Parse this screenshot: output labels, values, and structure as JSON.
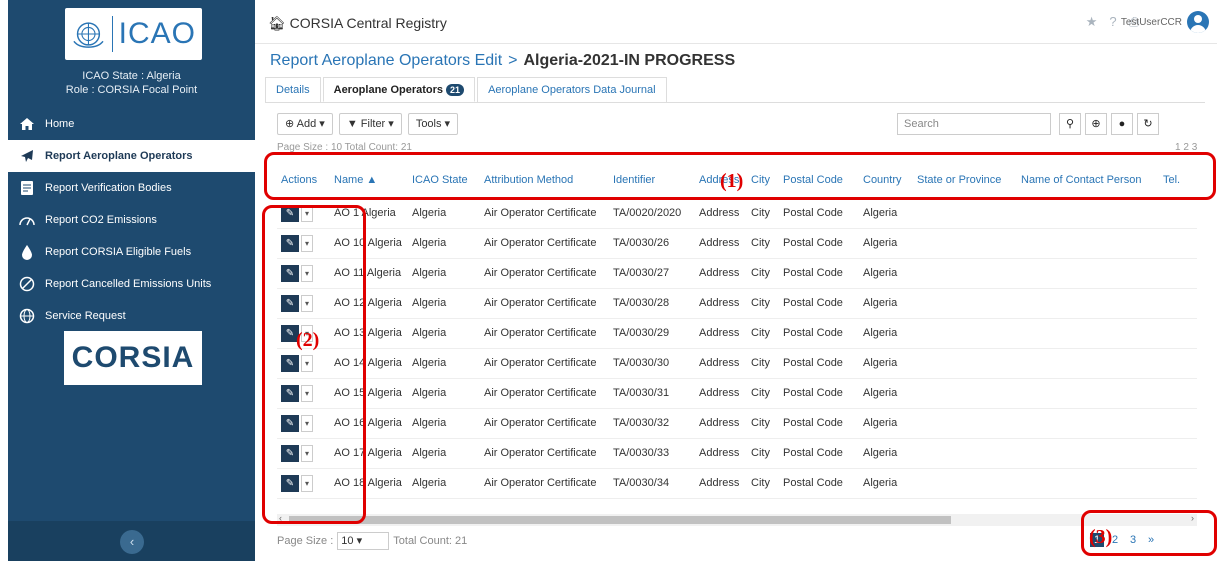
{
  "sidebar": {
    "logo_text": "ICAO",
    "state_line": "ICAO State : Algeria",
    "role_line": "Role : CORSIA Focal Point",
    "items": [
      {
        "label": "Home"
      },
      {
        "label": "Report Aeroplane Operators"
      },
      {
        "label": "Report Verification Bodies"
      },
      {
        "label": "Report CO2 Emissions"
      },
      {
        "label": "Report CORSIA Eligible Fuels"
      },
      {
        "label": "Report Cancelled Emissions Units"
      },
      {
        "label": "Service Request"
      }
    ],
    "corsia_logo": "CORSIA",
    "collapse": "‹"
  },
  "topbar": {
    "title": "CORSIA Central Registry",
    "user": "TestUserCCR"
  },
  "breadcrumb": {
    "link": "Report Aeroplane Operators Edit",
    "separator": ">",
    "current": "Algeria-2021-IN PROGRESS"
  },
  "tabs": [
    {
      "label": "Details"
    },
    {
      "label": "Aeroplane Operators",
      "badge": "21"
    },
    {
      "label": "Aeroplane Operators Data Journal"
    }
  ],
  "toolbar": {
    "add": "Add ▾",
    "filter": "Filter ▾",
    "tools": "Tools ▾",
    "search_placeholder": "Search"
  },
  "table": {
    "columns": [
      "Actions",
      "Name ▲",
      "ICAO State",
      "Attribution Method",
      "Identifier",
      "Address",
      "City",
      "Postal Code",
      "Country",
      "State or Province",
      "Name of Contact Person",
      "Tel."
    ],
    "rows": [
      [
        "AO 1 Algeria",
        "Algeria",
        "Air Operator Certificate",
        "TA/0020/2020",
        "Address",
        "City",
        "Postal Code",
        "Algeria"
      ],
      [
        "AO 10 Algeria",
        "Algeria",
        "Air Operator Certificate",
        "TA/0030/26",
        "Address",
        "City",
        "Postal Code",
        "Algeria"
      ],
      [
        "AO 11 Algeria",
        "Algeria",
        "Air Operator Certificate",
        "TA/0030/27",
        "Address",
        "City",
        "Postal Code",
        "Algeria"
      ],
      [
        "AO 12 Algeria",
        "Algeria",
        "Air Operator Certificate",
        "TA/0030/28",
        "Address",
        "City",
        "Postal Code",
        "Algeria"
      ],
      [
        "AO 13 Algeria",
        "Algeria",
        "Air Operator Certificate",
        "TA/0030/29",
        "Address",
        "City",
        "Postal Code",
        "Algeria"
      ],
      [
        "AO 14 Algeria",
        "Algeria",
        "Air Operator Certificate",
        "TA/0030/30",
        "Address",
        "City",
        "Postal Code",
        "Algeria"
      ],
      [
        "AO 15 Algeria",
        "Algeria",
        "Air Operator Certificate",
        "TA/0030/31",
        "Address",
        "City",
        "Postal Code",
        "Algeria"
      ],
      [
        "AO 16 Algeria",
        "Algeria",
        "Air Operator Certificate",
        "TA/0030/32",
        "Address",
        "City",
        "Postal Code",
        "Algeria"
      ],
      [
        "AO 17 Algeria",
        "Algeria",
        "Air Operator Certificate",
        "TA/0030/33",
        "Address",
        "City",
        "Postal Code",
        "Algeria"
      ],
      [
        "AO 18 Algeria",
        "Algeria",
        "Air Operator Certificate",
        "TA/0030/34",
        "Address",
        "City",
        "Postal Code",
        "Algeria"
      ]
    ]
  },
  "pager": {
    "page_size_label": "Page Size :",
    "page_size": "10",
    "total": "Total Count: 21",
    "pages": [
      "1",
      "2",
      "3"
    ],
    "next": "»"
  },
  "callouts": [
    "(1)",
    "(2)",
    "(3)"
  ],
  "colors": {
    "sidebar": "#1e4a6f",
    "accent": "#2a75b5",
    "annotation": "#e00000"
  }
}
